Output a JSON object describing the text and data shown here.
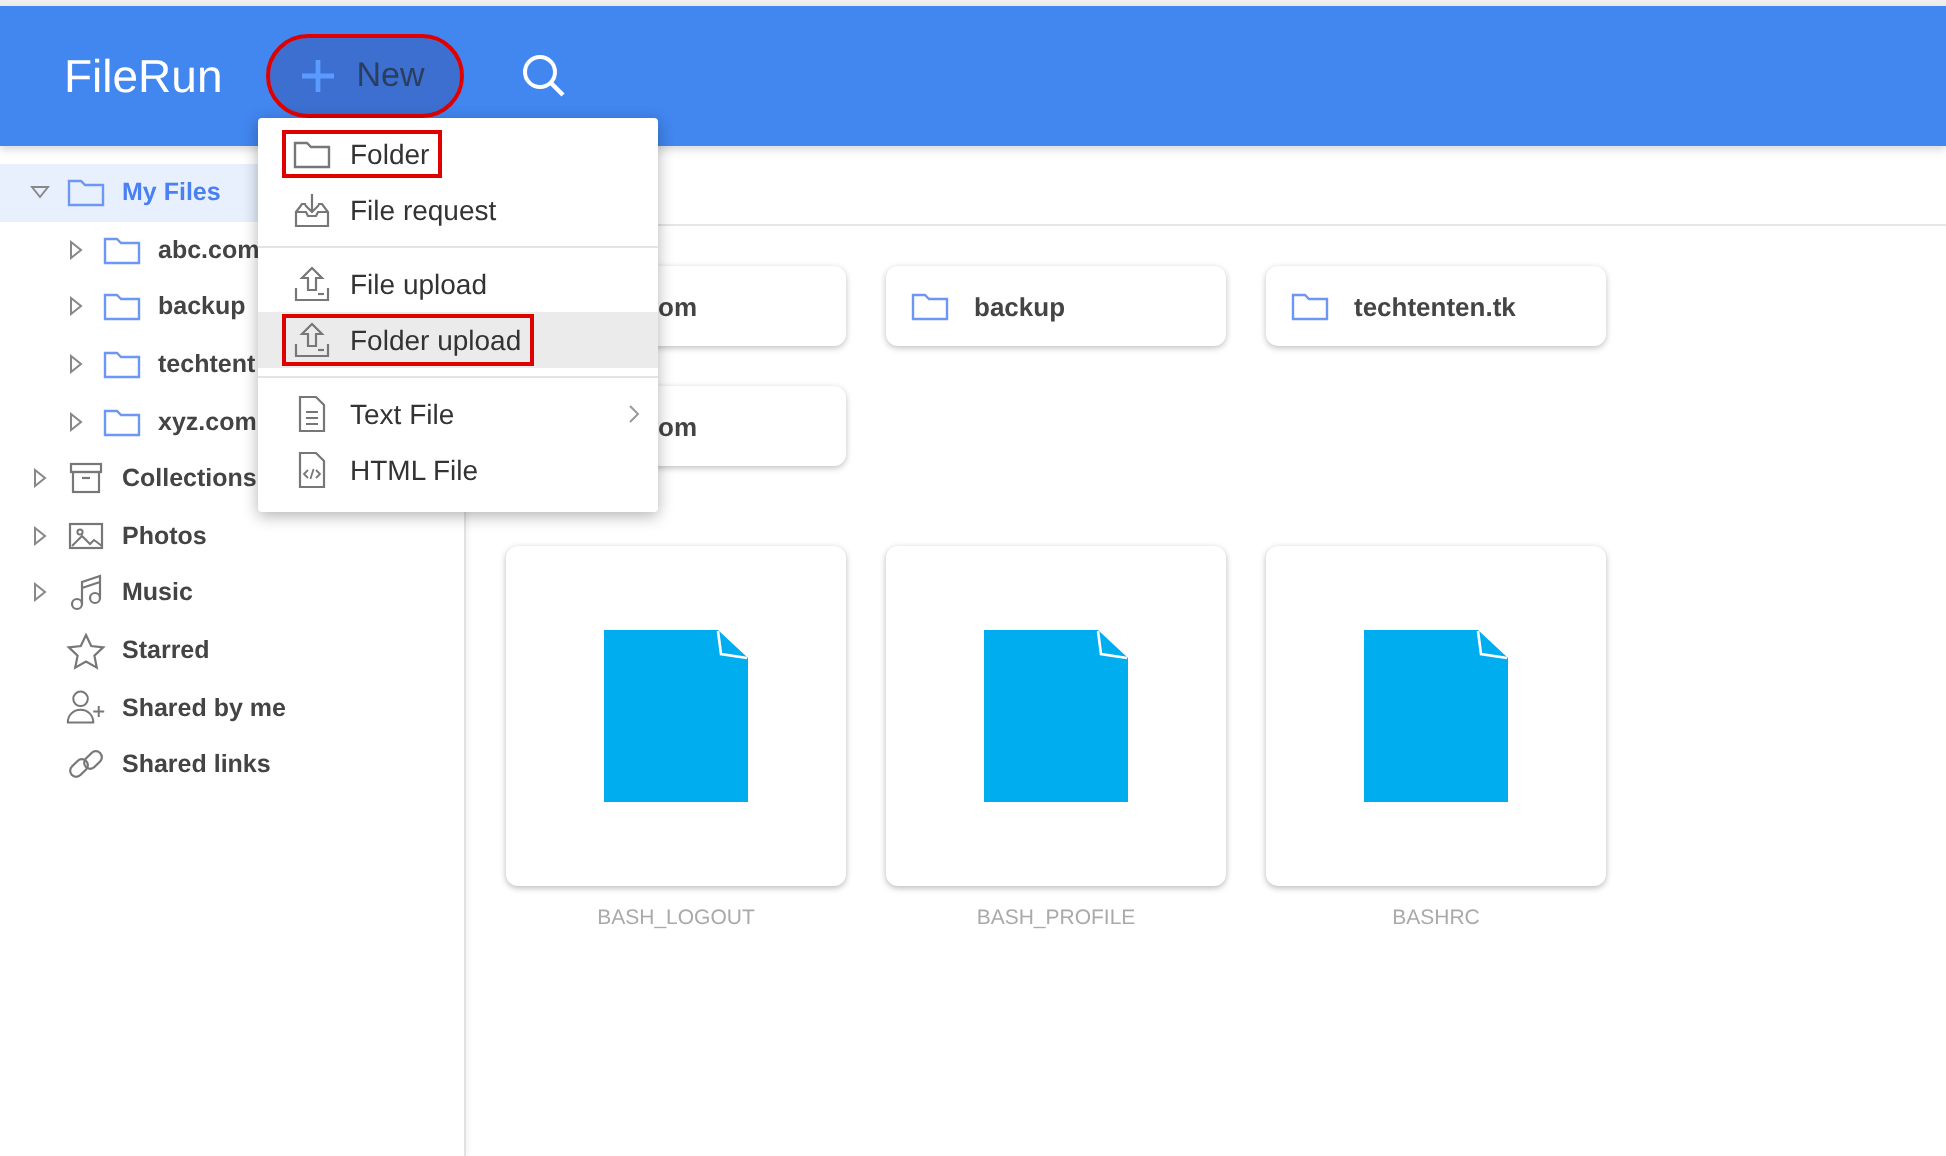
{
  "header": {
    "logo": "FileRun",
    "new_button": {
      "label": "New",
      "annotated": true
    }
  },
  "sidebar": {
    "items": [
      {
        "label": "My Files",
        "kind": "folder",
        "has_children": true,
        "expanded": true,
        "selected": true,
        "children": [
          {
            "label": "abc.com",
            "kind": "folder",
            "has_children": true,
            "expanded": false,
            "selected": false
          },
          {
            "label": "backup",
            "kind": "folder",
            "has_children": true,
            "expanded": false,
            "selected": false
          },
          {
            "label": "techtent",
            "kind": "folder",
            "has_children": true,
            "expanded": false,
            "selected": false
          },
          {
            "label": "xyz.com",
            "kind": "folder",
            "has_children": true,
            "expanded": false,
            "selected": false
          }
        ]
      },
      {
        "label": "Collections",
        "kind": "archive",
        "has_children": true,
        "expanded": false,
        "selected": false
      },
      {
        "label": "Photos",
        "kind": "photo",
        "has_children": true,
        "expanded": false,
        "selected": false
      },
      {
        "label": "Music",
        "kind": "music",
        "has_children": true,
        "expanded": false,
        "selected": false
      },
      {
        "label": "Starred",
        "kind": "star",
        "has_children": false,
        "selected": false
      },
      {
        "label": "Shared by me",
        "kind": "user",
        "has_children": false,
        "selected": false
      },
      {
        "label": "Shared links",
        "kind": "link",
        "has_children": false,
        "selected": false
      }
    ]
  },
  "folders": [
    {
      "name": "om",
      "covered": true
    },
    {
      "name": "backup",
      "covered": false
    },
    {
      "name": "techtenten.tk",
      "covered": false
    },
    {
      "name": "om",
      "covered": true
    }
  ],
  "files": [
    {
      "name": "BASH_LOGOUT"
    },
    {
      "name": "BASH_PROFILE"
    },
    {
      "name": "BASHRC"
    }
  ],
  "new_menu": {
    "groups": [
      [
        {
          "label": "Folder",
          "kind": "folder",
          "selected": false,
          "annotated": true,
          "submenu": false
        },
        {
          "label": "File request",
          "kind": "request",
          "selected": false,
          "annotated": false,
          "submenu": false
        }
      ],
      [
        {
          "label": "File upload",
          "kind": "upload",
          "selected": false,
          "annotated": false,
          "submenu": false
        },
        {
          "label": "Folder upload",
          "kind": "upload",
          "selected": true,
          "annotated": true,
          "submenu": false
        }
      ],
      [
        {
          "label": "Text File",
          "kind": "text",
          "selected": false,
          "annotated": false,
          "submenu": true
        },
        {
          "label": "HTML File",
          "kind": "html",
          "selected": false,
          "annotated": false,
          "submenu": false
        }
      ]
    ]
  }
}
